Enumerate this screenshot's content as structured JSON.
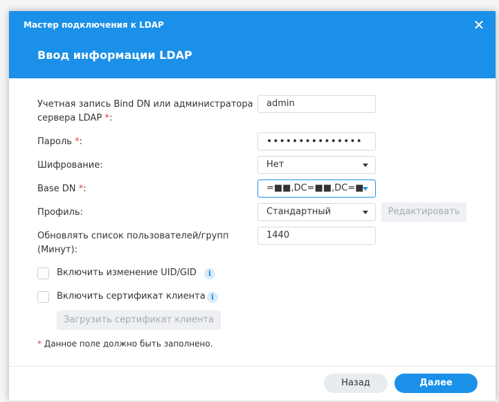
{
  "dialog": {
    "wizard_title": "Мастер подключения к LDAP",
    "step_title": "Ввод информации LDAP",
    "close_icon": "✕"
  },
  "form": {
    "bind_dn": {
      "label_line1": "Учетная запись Bind DN или администратора",
      "label_line2": "сервера LDAP",
      "required_mark": "*",
      "colon": ":",
      "value": "admin"
    },
    "password": {
      "label": "Пароль",
      "required_mark": "*",
      "colon": ":",
      "value": "•••••••••••••••"
    },
    "encryption": {
      "label": "Шифрование:",
      "value": "Нет"
    },
    "base_dn": {
      "label": "Base DN",
      "required_mark": "*",
      "colon": ":",
      "value": "=■■,DC=■■,DC=■"
    },
    "profile": {
      "label": "Профиль:",
      "value": "Стандартный",
      "edit_button": "Редактировать"
    },
    "refresh": {
      "label_line1": "Обновлять список пользователей/групп",
      "label_line2": "(Минут):",
      "value": "1440"
    },
    "uid_gid": {
      "label": "Включить изменение UID/GID",
      "info": "i"
    },
    "client_cert": {
      "label": "Включить сертификат клиента",
      "info": "i"
    },
    "upload_button": "Загрузить сертификат клиента",
    "required_note_mark": "*",
    "required_note": "Данное поле должно быть заполнено."
  },
  "footer": {
    "back": "Назад",
    "next": "Далее"
  },
  "colors": {
    "accent": "#1a90e8",
    "required": "#e63b3b",
    "disabled_text": "#a7abb2"
  }
}
